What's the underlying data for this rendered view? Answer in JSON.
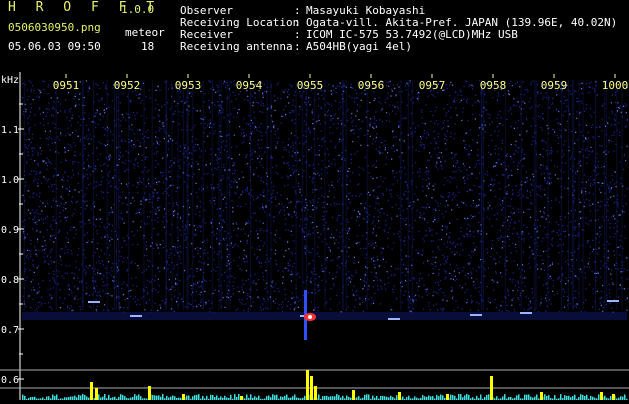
{
  "app": {
    "title": "H R O F F T",
    "version": "1.0.0"
  },
  "file": {
    "name": "0506030950.png",
    "datetime": "05.06.03 09:50"
  },
  "meteor": {
    "label": "meteor",
    "count": "18"
  },
  "info": [
    {
      "label": "Observer",
      "value": "Masayuki Kobayashi"
    },
    {
      "label": "Receiving Location",
      "value": "Ogata-vill. Akita-Pref. JAPAN (139.96E, 40.02N)"
    },
    {
      "label": "Receiver",
      "value": "ICOM IC-575 53.7492(@LCD)MHz USB"
    },
    {
      "label": "Receiving antenna",
      "value": "A504HB(yagi 4el)"
    }
  ],
  "separator": ":",
  "spectrogram": {
    "y_unit": "kHz",
    "y_ticks": [
      "1.1",
      "1.0",
      "0.9",
      "0.8",
      "0.7",
      "0.6"
    ],
    "time_ticks": [
      "0951",
      "0952",
      "0953",
      "0954",
      "0955",
      "0956",
      "0957",
      "0958",
      "0959",
      "1000"
    ],
    "colors": {
      "tick_text": "#ffff80",
      "axis_text": "#ffffff",
      "noise": "#2030c0",
      "bright": "#ff3030",
      "level": "#ffff00",
      "cyan": "#40e0e0"
    }
  }
}
